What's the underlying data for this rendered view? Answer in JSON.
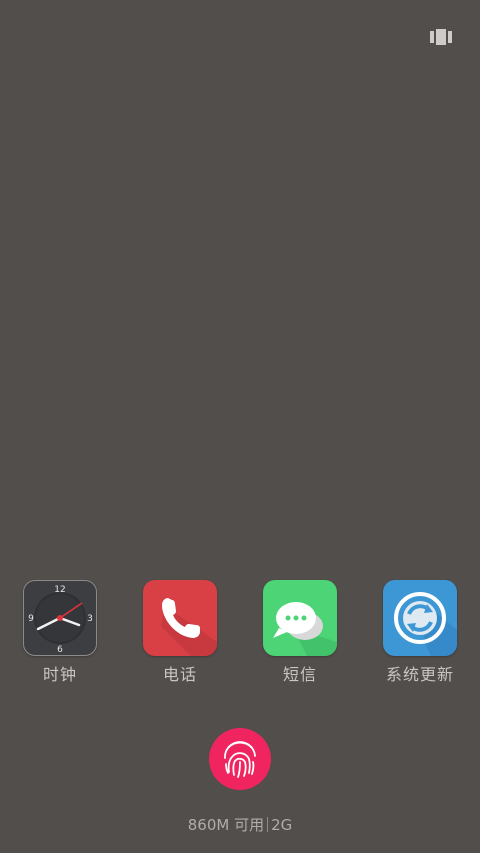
{
  "top_bar": {
    "icon": "recent-apps-icon"
  },
  "dock": {
    "apps": [
      {
        "label": "时钟",
        "icon": "clock-icon",
        "color": "#3d3e42",
        "clock_numbers": [
          "12",
          "3",
          "6",
          "9"
        ]
      },
      {
        "label": "电话",
        "icon": "phone-icon",
        "color": "#d94045"
      },
      {
        "label": "短信",
        "icon": "message-icon",
        "color": "#4cd477"
      },
      {
        "label": "系统更新",
        "icon": "system-update-icon",
        "color": "#3e97d5"
      }
    ]
  },
  "fingerprint": {
    "icon": "fingerprint-icon",
    "color": "#f0245f"
  },
  "status": {
    "memory": "860M 可用",
    "network": "2G"
  }
}
